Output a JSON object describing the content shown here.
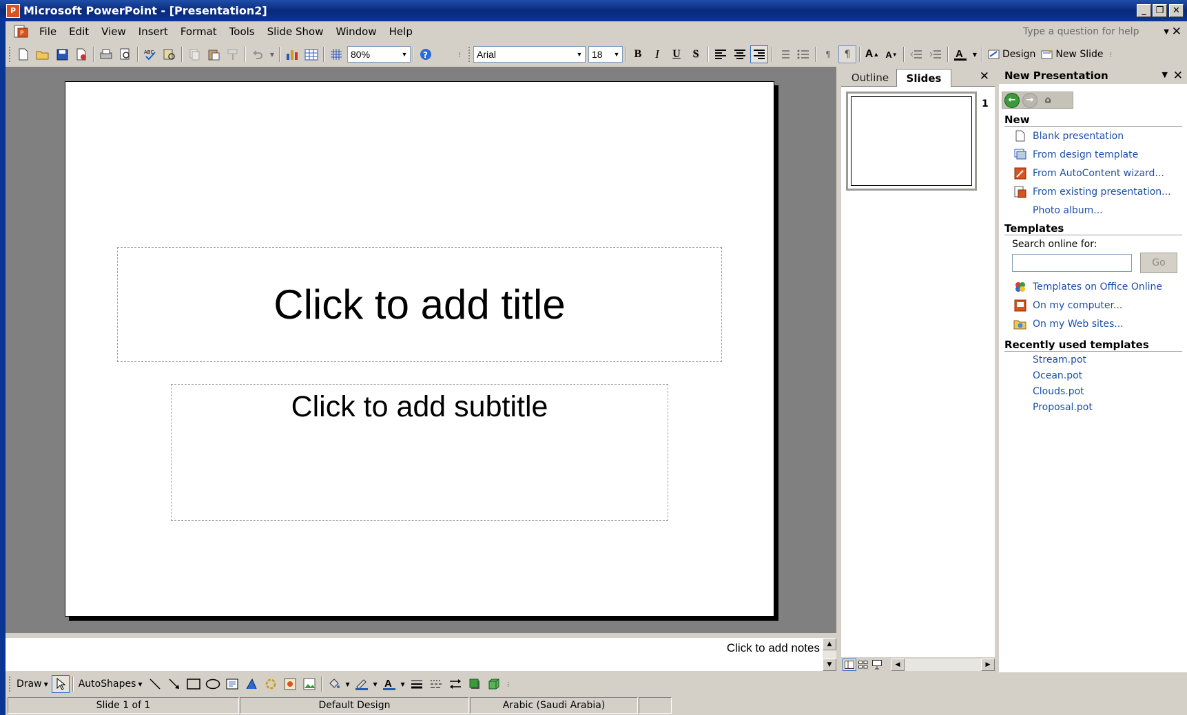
{
  "window": {
    "title": "Microsoft PowerPoint - [Presentation2]",
    "app_icon": "powerpoint-icon"
  },
  "menu": {
    "items": [
      "File",
      "Edit",
      "View",
      "Insert",
      "Format",
      "Tools",
      "Slide Show",
      "Window",
      "Help"
    ],
    "help_placeholder": "Type a question for help"
  },
  "toolbar": {
    "zoom": "80%",
    "font": "Arial",
    "font_size": "18",
    "design_label": "Design",
    "new_slide_label": "New Slide"
  },
  "slide": {
    "title_placeholder": "Click to add title",
    "subtitle_placeholder": "Click to add subtitle"
  },
  "notes": {
    "placeholder": "Click to add notes"
  },
  "thumb_pane": {
    "tabs": [
      "Outline",
      "Slides"
    ],
    "active_tab": "Slides",
    "slide_number": "1"
  },
  "task_pane": {
    "title": "New Presentation",
    "new_header": "New",
    "new_links": [
      {
        "label": "Blank presentation",
        "icon": "blank-doc-icon"
      },
      {
        "label": "From design template",
        "icon": "design-template-icon"
      },
      {
        "label": "From AutoContent wizard...",
        "icon": "wizard-icon"
      },
      {
        "label": "From existing presentation...",
        "icon": "existing-presentation-icon"
      },
      {
        "label": "Photo album...",
        "icon": ""
      }
    ],
    "templates_header": "Templates",
    "search_label": "Search online for:",
    "go_label": "Go",
    "template_links": [
      {
        "label": "Templates on Office Online",
        "icon": "office-online-icon"
      },
      {
        "label": "On my computer...",
        "icon": "computer-icon"
      },
      {
        "label": "On my Web sites...",
        "icon": "web-folder-icon"
      }
    ],
    "recent_header": "Recently used templates",
    "recent_links": [
      "Stream.pot",
      "Ocean.pot",
      "Clouds.pot",
      "Proposal.pot"
    ]
  },
  "draw_toolbar": {
    "draw_label": "Draw",
    "autoshapes_label": "AutoShapes"
  },
  "status": {
    "slide": "Slide 1 of 1",
    "design": "Default Design",
    "language": "Arabic (Saudi Arabia)"
  },
  "colors": {
    "titlebar": "#0a2a7c",
    "chrome": "#d4d0c8",
    "link": "#1c4ea7",
    "slide_backdrop": "#808080"
  }
}
